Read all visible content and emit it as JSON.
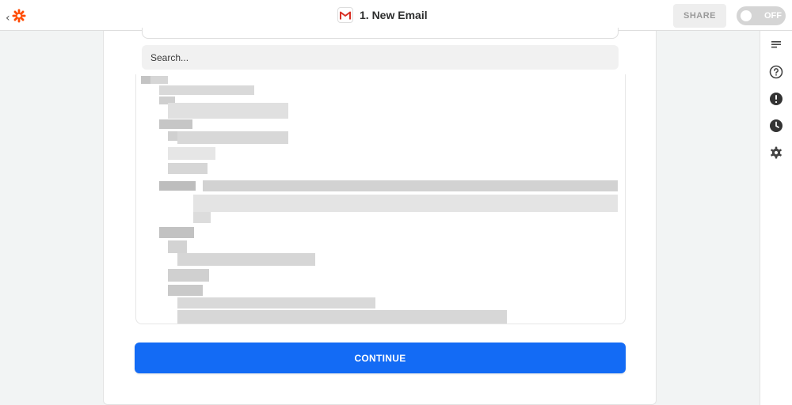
{
  "header": {
    "title": "1. New Email",
    "share_label": "SHARE",
    "toggle_label": "OFF",
    "brand_color": "#ff4a00",
    "app_icon": "gmail-icon"
  },
  "search": {
    "placeholder": "Search..."
  },
  "continue_label": "CONTINUE",
  "colors": {
    "accent": "#136bf5"
  },
  "sidebar": {
    "icons": [
      "details-icon",
      "help-icon",
      "alert-icon",
      "history-icon",
      "settings-icon"
    ]
  }
}
